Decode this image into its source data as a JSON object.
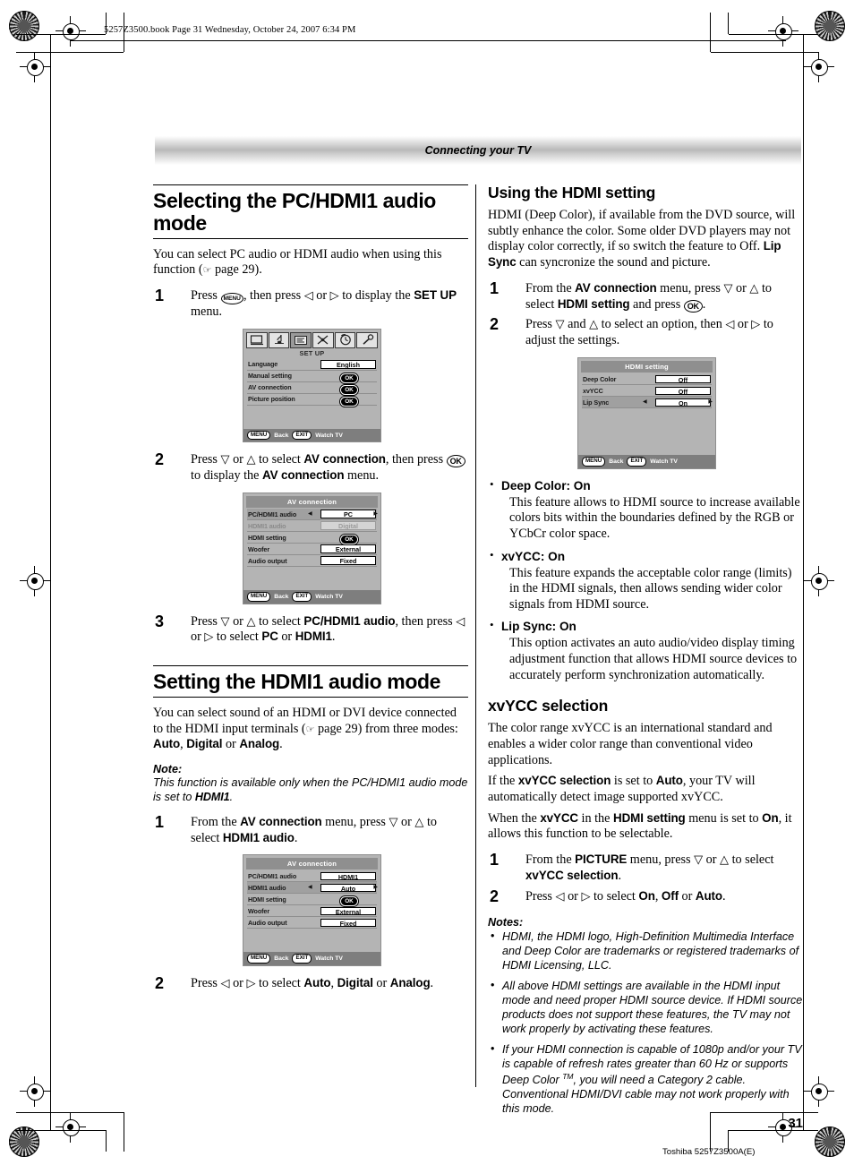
{
  "print": {
    "file_stamp": "5257Z3500.book  Page 31  Wednesday, October 24, 2007  6:34 PM",
    "colophon": "Toshiba 5257Z3500A(E)",
    "page_number": "31"
  },
  "header": {
    "running_title": "Connecting your TV"
  },
  "left_column": {
    "section1_title": "Selecting the PC/HDMI1 audio mode",
    "section1_intro_a": "You can select PC audio or HDMI audio when using this function (",
    "section1_intro_b": " page 29).",
    "step1_a": "Press ",
    "step1_key": "MENU",
    "step1_b": ", then press ",
    "step1_c": " or ",
    "step1_d": " to display the ",
    "step1_bold": "SET UP",
    "step1_e": " menu.",
    "step2_a": "Press ",
    "step2_b": " or ",
    "step2_c": " to select ",
    "step2_bold1": "AV connection",
    "step2_d": ", then press ",
    "step2_key": "OK",
    "step2_e": " to display the ",
    "step2_bold2": "AV connection",
    "step2_f": " menu.",
    "step3_a": "Press ",
    "step3_b": " or ",
    "step3_c": " to select ",
    "step3_bold1": "PC/HDMI1 audio",
    "step3_d": ", then press ",
    "step3_e": " or ",
    "step3_f": " to select ",
    "step3_bold2": "PC",
    "step3_g": " or ",
    "step3_bold3": "HDMI1",
    "step3_h": ".",
    "section2_title": "Setting the HDMI1 audio mode",
    "section2_intro_a": "You can select sound of an HDMI or DVI device connected to the HDMI input terminals (",
    "section2_intro_b": " page 29) from three modes: ",
    "section2_bold1": "Auto",
    "section2_intro_c": ", ",
    "section2_bold2": "Digital",
    "section2_intro_d": " or ",
    "section2_bold3": "Analog",
    "section2_intro_e": ".",
    "note_label": "Note:",
    "note_text_a": "This function is available only when the PC/HDMI1 audio mode is set to ",
    "note_bold": "HDMI1",
    "note_text_b": ".",
    "s2step1_a": "From the ",
    "s2step1_bold1": "AV connection",
    "s2step1_b": " menu, press ",
    "s2step1_c": " or ",
    "s2step1_d": " to select ",
    "s2step1_bold2": "HDMI1 audio",
    "s2step1_e": ".",
    "s2step2_a": "Press ",
    "s2step2_b": " or ",
    "s2step2_c": " to select ",
    "s2step2_bold1": "Auto",
    "s2step2_d": ", ",
    "s2step2_bold2": "Digital",
    "s2step2_e": " or ",
    "s2step2_bold3": "Analog",
    "s2step2_f": "."
  },
  "right_column": {
    "section1_title": "Using the HDMI setting",
    "intro_a": "HDMI (Deep Color), if available from the DVD source, will subtly enhance the color. Some older DVD players may not display color correctly, if so switch the feature to Off. ",
    "intro_bold": "Lip Sync",
    "intro_b": " can syncronize the sound and picture.",
    "step1_a": "From the ",
    "step1_bold1": "AV connection",
    "step1_b": " menu, press ",
    "step1_c": " or ",
    "step1_d": " to select ",
    "step1_bold2": "HDMI setting",
    "step1_e": " and press ",
    "step1_key": "OK",
    "step1_f": ".",
    "step2_a": "Press ",
    "step2_b": " and ",
    "step2_c": " to select an option, then ",
    "step2_d": " or ",
    "step2_e": " to adjust the settings.",
    "features": [
      {
        "title": "Deep Color: On",
        "desc": "This feature allows to HDMI source to increase available colors bits within the boundaries defined by the RGB or YCbCr color space."
      },
      {
        "title": "xvYCC: On",
        "desc": "This feature expands the acceptable color range (limits) in the HDMI signals, then allows sending wider color signals from HDMI source."
      },
      {
        "title": "Lip Sync: On",
        "desc": "This option activates an auto audio/video display timing adjustment function that allows HDMI source devices to accurately perform synchronization automatically."
      }
    ],
    "section2_title": "xvYCC selection",
    "xv_p1": "The color range xvYCC is an international standard and enables a wider color range than conventional video applications.",
    "xv_p2_a": "If the ",
    "xv_p2_bold1": "xvYCC selection",
    "xv_p2_b": " is set to ",
    "xv_p2_bold2": "Auto",
    "xv_p2_c": ", your TV will automatically detect image supported xvYCC.",
    "xv_p3_a": "When the ",
    "xv_p3_bold1": "xvYCC",
    "xv_p3_b": " in the ",
    "xv_p3_bold2": "HDMI setting",
    "xv_p3_c": " menu is set to ",
    "xv_p3_bold3": "On",
    "xv_p3_d": ", it allows this function to be selectable.",
    "xvstep1_a": "From the ",
    "xvstep1_bold1": "PICTURE",
    "xvstep1_b": " menu, press ",
    "xvstep1_c": " or ",
    "xvstep1_d": " to select ",
    "xvstep1_bold2": "xvYCC selection",
    "xvstep1_e": ".",
    "xvstep2_a": "Press ",
    "xvstep2_b": " or ",
    "xvstep2_c": " to select ",
    "xvstep2_bold1": "On",
    "xvstep2_d": ", ",
    "xvstep2_bold2": "Off",
    "xvstep2_e": " or ",
    "xvstep2_bold3": "Auto",
    "xvstep2_f": ".",
    "notes_label": "Notes:",
    "notes": [
      "HDMI, the HDMI logo, High-Definition Multimedia Interface and Deep Color are trademarks or registered trademarks of HDMI Licensing, LLC.",
      "All above HDMI settings are available in the HDMI input mode and need proper HDMI source device. If HDMI source products does not support these features, the TV may not work properly by activating these features."
    ],
    "note3_a": "If your HDMI connection is capable of 1080p and/or your TV is capable of refresh rates greater than 60 Hz or supports Deep Color ",
    "note3_sup": "TM",
    "note3_b": ", you will need a Category 2 cable. Conventional HDMI/DVI cable may not work properly with this mode."
  },
  "osd_setup": {
    "tabs": [
      "picture-icon",
      "audio-note-icon",
      "setup-list-icon",
      "feature-scissors-icon",
      "timer-clock-icon",
      "lock-key-icon"
    ],
    "active_tab_index": 2,
    "title": "SET UP",
    "rows": [
      {
        "label": "Language",
        "value": "English",
        "type": "value",
        "state": "normal"
      },
      {
        "label": "Manual setting",
        "value": "OK",
        "type": "ok",
        "state": "normal"
      },
      {
        "label": "AV connection",
        "value": "OK",
        "type": "ok",
        "state": "normal"
      },
      {
        "label": "Picture position",
        "value": "OK",
        "type": "ok",
        "state": "normal"
      }
    ],
    "footer": {
      "back_key": "MENU",
      "back_label": "Back",
      "exit_key": "EXIT",
      "exit_label": "Watch TV"
    }
  },
  "osd_av1": {
    "title": "AV connection",
    "rows": [
      {
        "label": "PC/HDMI1 audio",
        "value": "PC",
        "type": "value",
        "state": "selected"
      },
      {
        "label": "HDMI1 audio",
        "value": "Digital",
        "type": "value",
        "state": "dim"
      },
      {
        "label": "HDMI setting",
        "value": "OK",
        "type": "ok",
        "state": "normal"
      },
      {
        "label": "Woofer",
        "value": "External",
        "type": "value",
        "state": "normal"
      },
      {
        "label": "Audio output",
        "value": "Fixed",
        "type": "value",
        "state": "normal"
      }
    ],
    "footer": {
      "back_key": "MENU",
      "back_label": "Back",
      "exit_key": "EXIT",
      "exit_label": "Watch TV"
    }
  },
  "osd_av2": {
    "title": "AV connection",
    "rows": [
      {
        "label": "PC/HDMI1 audio",
        "value": "HDMI1",
        "type": "value",
        "state": "normal"
      },
      {
        "label": "HDMI1 audio",
        "value": "Auto",
        "type": "value",
        "state": "selected"
      },
      {
        "label": "HDMI setting",
        "value": "OK",
        "type": "ok",
        "state": "normal"
      },
      {
        "label": "Woofer",
        "value": "External",
        "type": "value",
        "state": "normal"
      },
      {
        "label": "Audio output",
        "value": "Fixed",
        "type": "value",
        "state": "normal"
      }
    ],
    "footer": {
      "back_key": "MENU",
      "back_label": "Back",
      "exit_key": "EXIT",
      "exit_label": "Watch TV"
    }
  },
  "osd_hdmi": {
    "title": "HDMI setting",
    "rows": [
      {
        "label": "Deep Color",
        "value": "Off",
        "type": "value",
        "state": "normal"
      },
      {
        "label": "xvYCC",
        "value": "Off",
        "type": "value",
        "state": "normal"
      },
      {
        "label": "Lip Sync",
        "value": "On",
        "type": "value",
        "state": "selected"
      }
    ],
    "footer": {
      "back_key": "MENU",
      "back_label": "Back",
      "exit_key": "EXIT",
      "exit_label": "Watch TV"
    }
  }
}
